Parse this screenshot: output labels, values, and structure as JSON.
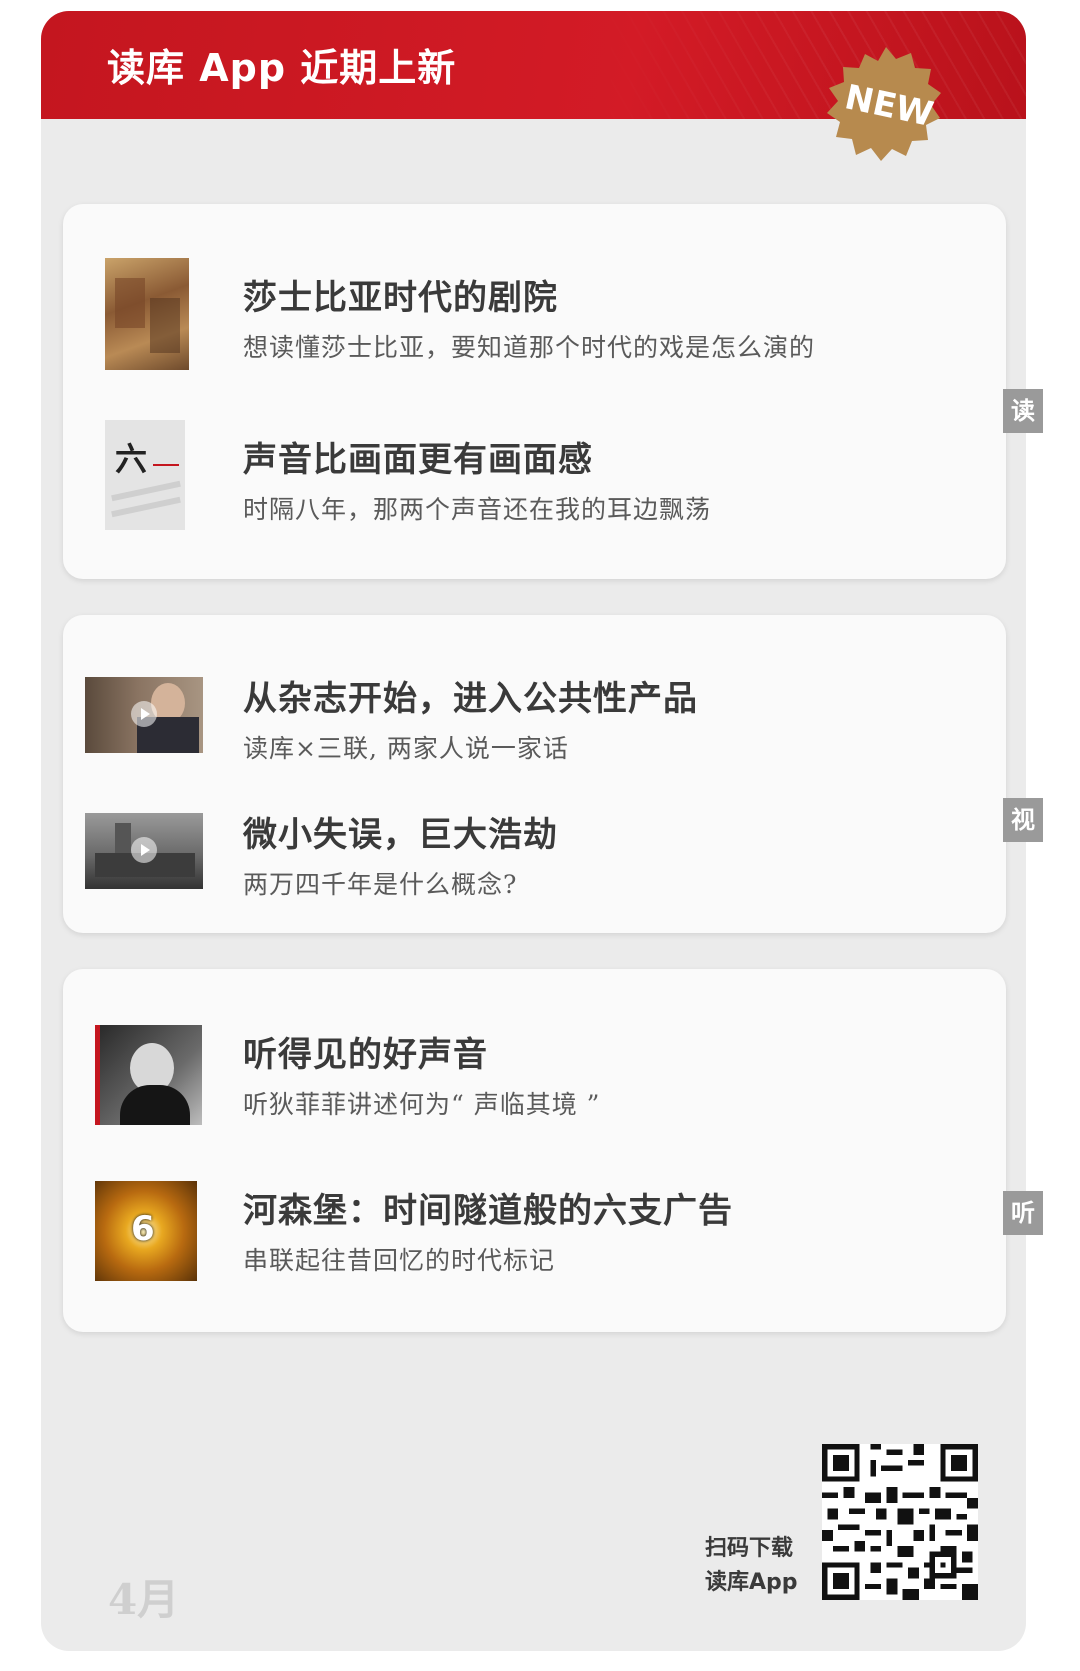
{
  "header": {
    "title": "读库 App 近期上新",
    "badge": "NEW"
  },
  "sections": {
    "read": {
      "tab": "读",
      "items": [
        {
          "title": "莎士比亚时代的剧院",
          "subtitle": "想读懂莎士比亚，要知道那个时代的戏是怎么演的"
        },
        {
          "title": "声音比画面更有画面感",
          "subtitle": "时隔八年，那两个声音还在我的耳边飘荡",
          "thumb_text": "六"
        }
      ]
    },
    "watch": {
      "tab": "视",
      "items": [
        {
          "title": "从杂志开始，进入公共性产品",
          "subtitle": "读库×三联, 两家人说一家话"
        },
        {
          "title": "微小失误，巨大浩劫",
          "subtitle": "两万四千年是什么概念?"
        }
      ]
    },
    "listen": {
      "tab": "听",
      "items": [
        {
          "title": "听得见的好声音",
          "subtitle": "听狄菲菲讲述何为“ 声临其境 ”"
        },
        {
          "title": "河森堡：时间隧道般的六支广告",
          "subtitle": "串联起往昔回忆的时代标记",
          "thumb_text": "6"
        }
      ]
    }
  },
  "footer": {
    "month": "4月",
    "scan_line1": "扫码下载",
    "scan_line2": "读库App"
  },
  "colors": {
    "header_red": "#d31b26",
    "badge_gold": "#b78a4e",
    "tab_gray": "#9a9a9a",
    "panel_bg": "#ebebeb"
  }
}
